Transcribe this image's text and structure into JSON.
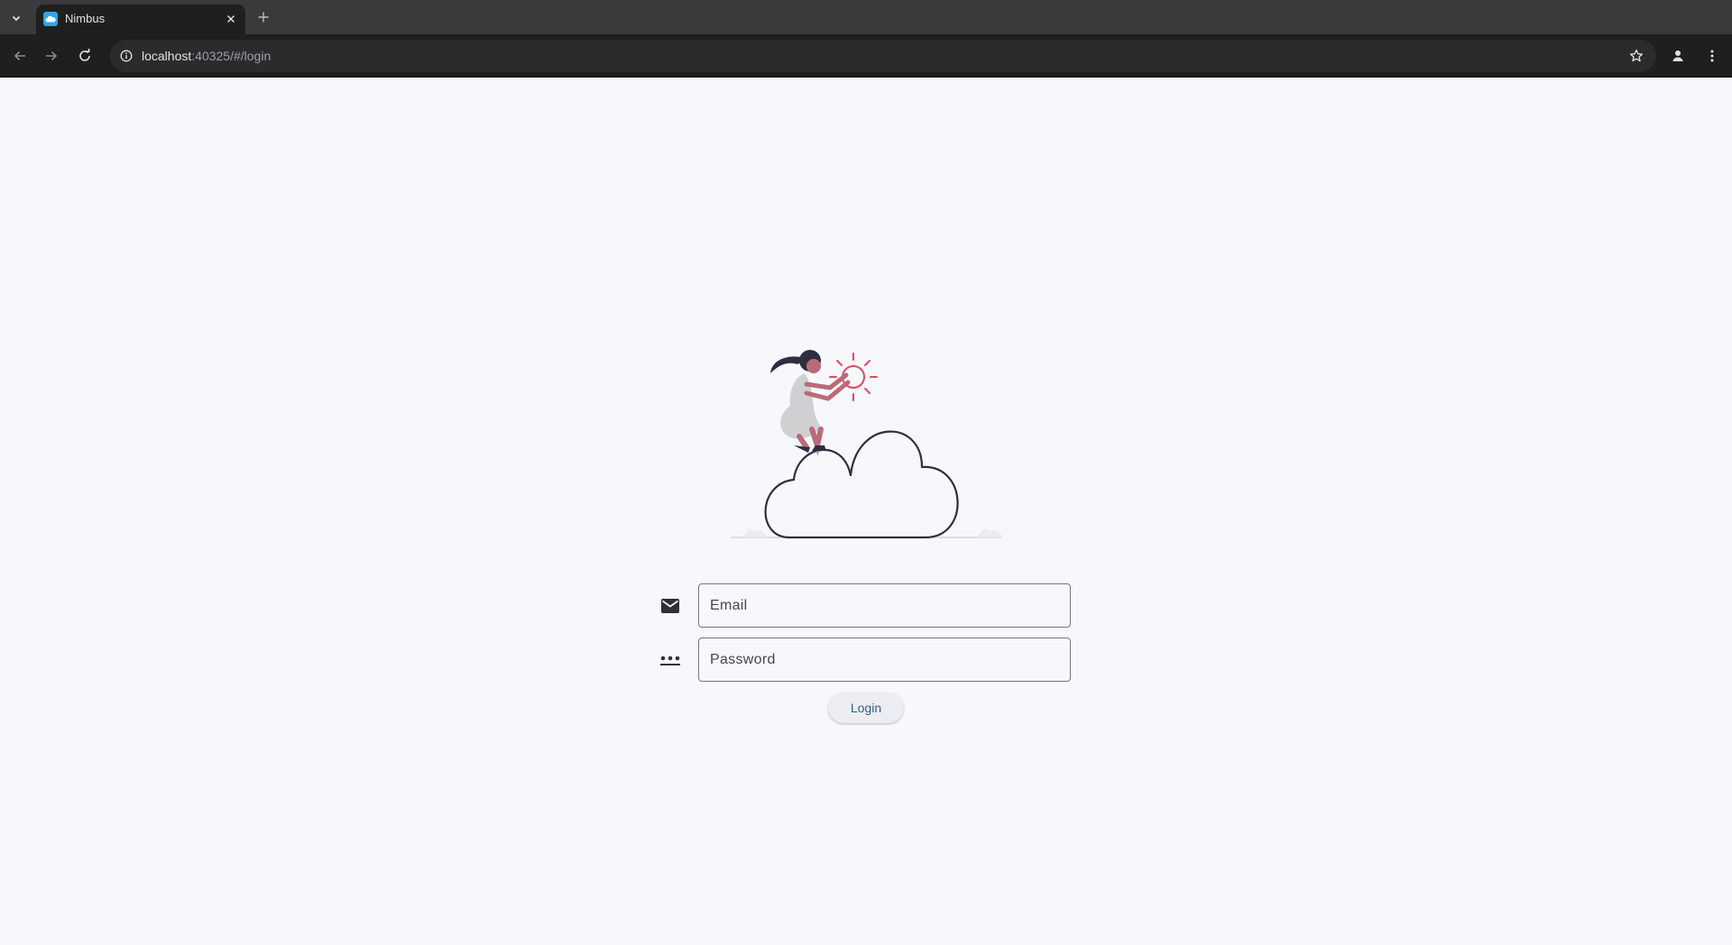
{
  "browser": {
    "tab": {
      "title": "Nimbus",
      "favicon": "cloud-favicon-icon"
    },
    "address": {
      "host": "localhost",
      "rest": ":40325/#/login"
    },
    "icons": {
      "tab_list": "chevron-down-icon",
      "tab_close": "close-icon",
      "new_tab": "plus-icon",
      "back": "arrow-left-icon",
      "forward": "arrow-right-icon",
      "reload": "reload-icon",
      "site_info": "info-icon",
      "bookmark": "star-icon",
      "profile": "person-icon",
      "menu": "kebab-menu-icon"
    }
  },
  "login": {
    "illustration": "woman-on-cloud-with-sun-illustration",
    "email": {
      "placeholder": "Email",
      "value": "",
      "icon": "mail-icon"
    },
    "password": {
      "placeholder": "Password",
      "value": "",
      "icon": "password-dots-icon"
    },
    "submit_label": "Login"
  },
  "colors": {
    "page_background": "#f7f8fc",
    "button_text": "#2f5f8f",
    "accent_red": "#e6475f",
    "cloud_outline": "#2f2e41"
  }
}
